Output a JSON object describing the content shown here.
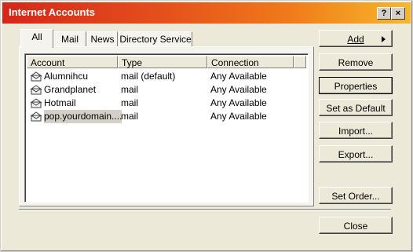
{
  "window": {
    "title": "Internet Accounts",
    "help_glyph": "?",
    "close_glyph": "×"
  },
  "tabs": [
    "All",
    "Mail",
    "News",
    "Directory Service"
  ],
  "active_tab": "All",
  "table": {
    "columns": [
      "Account",
      "Type",
      "Connection"
    ],
    "rows": [
      {
        "account": "Alumnihcu",
        "type": "mail (default)",
        "connection": "Any Available"
      },
      {
        "account": "Grandplanet",
        "type": "mail",
        "connection": "Any Available"
      },
      {
        "account": "Hotmail",
        "type": "mail",
        "connection": "Any Available"
      },
      {
        "account": "pop.yourdomain....",
        "type": "mail",
        "connection": "Any Available"
      }
    ]
  },
  "buttons": {
    "add": "Add",
    "remove": "Remove",
    "properties": "Properties",
    "set_default": "Set as Default",
    "import": "Import...",
    "export": "Export...",
    "set_order": "Set Order...",
    "close": "Close"
  }
}
